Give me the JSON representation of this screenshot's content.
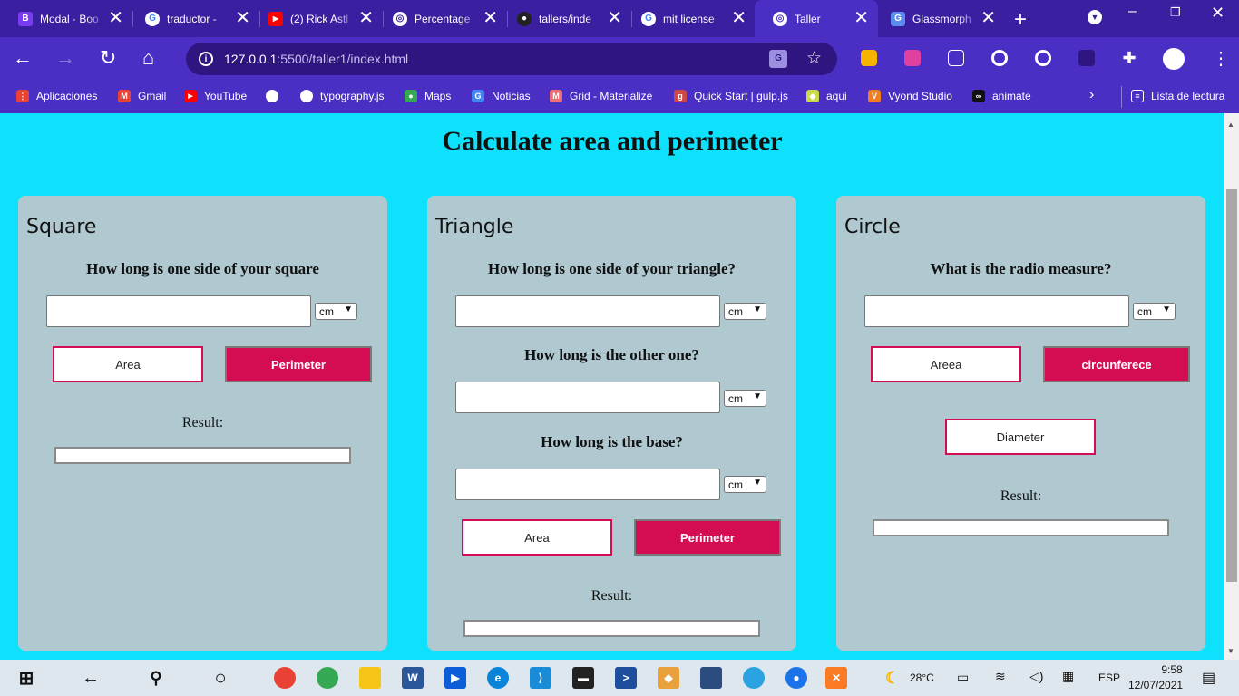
{
  "browser": {
    "tabs": [
      {
        "label": "Modal · Boo",
        "favicon": "B",
        "color": "#7a3cf0"
      },
      {
        "label": "traductor - ",
        "favicon": "G",
        "color": "#ffffff"
      },
      {
        "label": "(2) Rick Astl",
        "favicon": "▶",
        "color": "#ff0000"
      },
      {
        "label": "Percentage",
        "favicon": "◎",
        "color": "#ffffff"
      },
      {
        "label": "tallers/inde",
        "favicon": "●",
        "color": "#222222"
      },
      {
        "label": "mit license",
        "favicon": "G",
        "color": "#ffffff"
      },
      {
        "label": "Taller",
        "favicon": "◎",
        "color": "#ffffff"
      },
      {
        "label": "Glassmorph",
        "favicon": "G",
        "color": "#5b8def"
      }
    ],
    "url_host": "127.0.0.1",
    "url_path": ":5500/taller1/index.html",
    "bookmarks": [
      {
        "label": "Aplicaciones",
        "color": "#e94235"
      },
      {
        "label": "Gmail",
        "color": "#ea4335"
      },
      {
        "label": "YouTube",
        "color": "#ff0000"
      },
      {
        "label": "",
        "color": "#2e1580"
      },
      {
        "label": "typography.js",
        "color": "#2e1580"
      },
      {
        "label": "Maps",
        "color": "#34a853"
      },
      {
        "label": "Noticias",
        "color": "#4285f4"
      },
      {
        "label": "Grid - Materialize",
        "color": "#ee6e73"
      },
      {
        "label": "Quick Start | gulp.js",
        "color": "#cf4647"
      },
      {
        "label": "aqui",
        "color": "#c8d94a"
      },
      {
        "label": "Vyond Studio",
        "color": "#f07d22"
      },
      {
        "label": "animate",
        "color": "#111111"
      }
    ],
    "reading_list": "Lista de lectura"
  },
  "page": {
    "title": "Calculate area and perimeter",
    "unit_option": "cm",
    "result_label": "Result:",
    "square": {
      "heading": "Square",
      "question": "How long is one side of your square",
      "area_button": "Area",
      "perimeter_button": "Perimeter"
    },
    "triangle": {
      "heading": "Triangle",
      "question1": "How long is one side of your triangle?",
      "question2": "How long is the other one?",
      "question3": "How long is the base?",
      "area_button": "Area",
      "perimeter_button": "Perimeter"
    },
    "circle": {
      "heading": "Circle",
      "question": "What is the radio measure?",
      "area_button": "Areea",
      "circumference_button": "circunferece",
      "diameter_button": "Diameter"
    }
  },
  "taskbar": {
    "temperature": "28°C",
    "language": "ESP",
    "time": "9:58",
    "date": "12/07/2021"
  }
}
